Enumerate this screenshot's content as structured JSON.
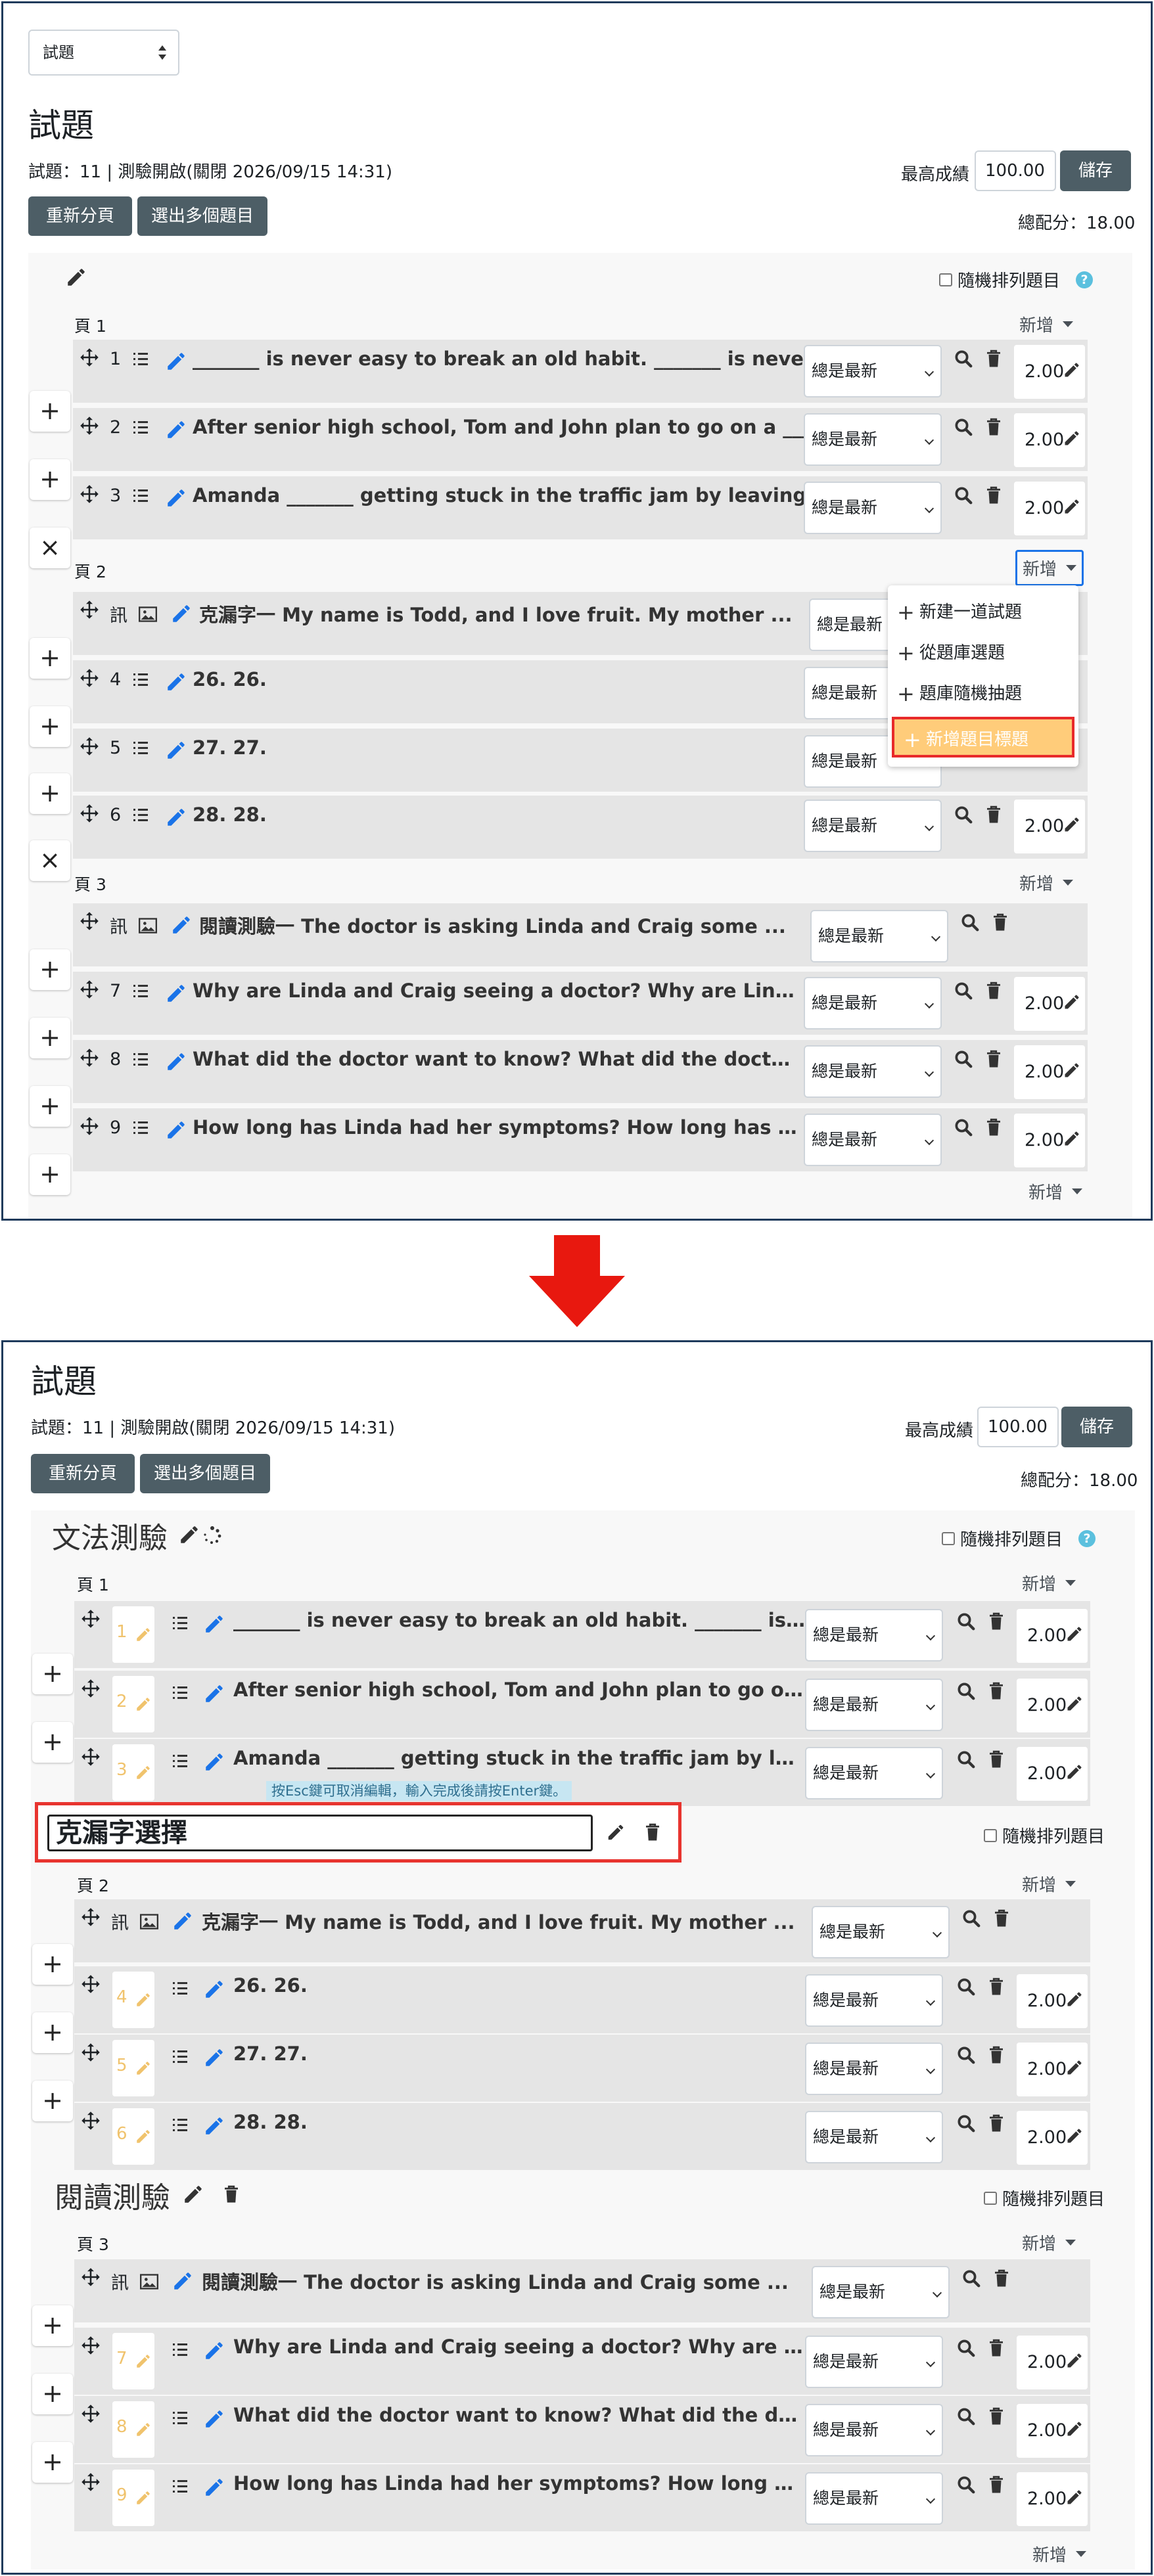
{
  "colors": {
    "frame": "#1f3b5c",
    "dark_button": "#4d5e66",
    "row_bg": "#e5e5e5",
    "pencil_blue": "#1a73e8",
    "highlight_bg": "#ffcc7a",
    "highlight_border": "#e82a2a",
    "arrow_red": "#e8180f",
    "help_blue": "#5bc0de"
  },
  "before": {
    "top_select": "試題",
    "title": "試題",
    "info": "試題：11 | 測驗開啟(關閉 2026/09/15 14:31)",
    "max_grade_label": "最高成績",
    "max_grade_value": "100.00",
    "save_button": "儲存",
    "repaginate_button": "重新分頁",
    "select_multiple_button": "選出多個題目",
    "total_marks": "總配分：18.00",
    "shuffle_label": "隨機排列題目",
    "help": "?",
    "add_label": "新增",
    "pages": [
      {
        "label": "頁 1"
      },
      {
        "label": "頁 2"
      },
      {
        "label": "頁 3"
      }
    ],
    "questions": [
      {
        "num": "1",
        "text": "_______ is never easy to break an old habit. _______ is never easy to break an old habit.",
        "version": "總是最新",
        "mark": "2.00"
      },
      {
        "num": "2",
        "text": "After senior high school, Tom and John plan to go on a _______",
        "version": "總是最新",
        "mark": "2.00"
      },
      {
        "num": "3",
        "text": "Amanda _______ getting stuck in the traffic jam by leaving home early",
        "version": "總是最新",
        "mark": "2.00"
      },
      {
        "num": "訊",
        "text": "克漏字一 My name is Todd, and I love fruit. My mother ...",
        "version": "總是最新",
        "mark": ""
      },
      {
        "num": "4",
        "text": "26. 26.",
        "version": "總是最新",
        "mark": "2.00"
      },
      {
        "num": "5",
        "text": "27. 27.",
        "version": "總是最新",
        "mark": "2.00"
      },
      {
        "num": "6",
        "text": "28. 28.",
        "version": "總是最新",
        "mark": "2.00"
      },
      {
        "num": "訊",
        "text": "閱讀測驗一 The doctor is asking Linda and Craig some ...",
        "version": "總是最新",
        "mark": ""
      },
      {
        "num": "7",
        "text": "Why are Linda and Craig seeing a doctor? Why are Linda and Craig seeing a doctor?",
        "version": "總是最新",
        "mark": "2.00"
      },
      {
        "num": "8",
        "text": "What did the doctor want to know? What did the doctor want to know?",
        "version": "總是最新",
        "mark": "2.00"
      },
      {
        "num": "9",
        "text": "How long has Linda had her symptoms? How long has Linda had her symptoms?",
        "version": "總是最新",
        "mark": "2.00"
      }
    ],
    "dropdown": {
      "items": [
        "新建一道試題",
        "從題庫選題",
        "題庫隨機抽題",
        "新增題目標題"
      ]
    },
    "plus": "+",
    "times": "×"
  },
  "after": {
    "title": "試題",
    "info": "試題：11 | 測驗開啟(關閉 2026/09/15 14:31)",
    "max_grade_label": "最高成績",
    "max_grade_value": "100.00",
    "save_button": "儲存",
    "repaginate_button": "重新分頁",
    "select_multiple_button": "選出多個題目",
    "total_marks": "總配分：18.00",
    "shuffle_label": "隨機排列題目",
    "help": "?",
    "add_label": "新增",
    "section1_title": "文法測驗",
    "section2_title": "克漏字選擇",
    "section3_title": "閱讀測驗",
    "edit_hint": "按Esc鍵可取消編輯，輸入完成後請按Enter鍵。",
    "pages": [
      {
        "label": "頁 1"
      },
      {
        "label": "頁 2"
      },
      {
        "label": "頁 3"
      }
    ],
    "questions": [
      {
        "num": "1",
        "text": "_______ is never easy to break an old habit. _______ is never easy to break an old habit.",
        "version": "總是最新",
        "mark": "2.00"
      },
      {
        "num": "2",
        "text": "After senior high school, Tom and John plan to go on a _______",
        "version": "總是最新",
        "mark": "2.00"
      },
      {
        "num": "3",
        "text": "Amanda _______ getting stuck in the traffic jam by leaving home early",
        "version": "總是最新",
        "mark": "2.00"
      },
      {
        "num": "訊",
        "text": "克漏字一 My name is Todd, and I love fruit. My mother ...",
        "version": "總是最新",
        "mark": ""
      },
      {
        "num": "4",
        "text": "26. 26.",
        "version": "總是最新",
        "mark": "2.00"
      },
      {
        "num": "5",
        "text": "27. 27.",
        "version": "總是最新",
        "mark": "2.00"
      },
      {
        "num": "6",
        "text": "28. 28.",
        "version": "總是最新",
        "mark": "2.00"
      },
      {
        "num": "訊",
        "text": "閱讀測驗一 The doctor is asking Linda and Craig some ...",
        "version": "總是最新",
        "mark": ""
      },
      {
        "num": "7",
        "text": "Why are Linda and Craig seeing a doctor? Why are Linda and Craig seeing a doctor?",
        "version": "總是最新",
        "mark": "2.00"
      },
      {
        "num": "8",
        "text": "What did the doctor want to know? What did the doctor want to know?",
        "version": "總是最新",
        "mark": "2.00"
      },
      {
        "num": "9",
        "text": "How long has Linda had her symptoms? How long has Linda had her symptoms?",
        "version": "總是最新",
        "mark": "2.00"
      }
    ],
    "plus": "+"
  }
}
